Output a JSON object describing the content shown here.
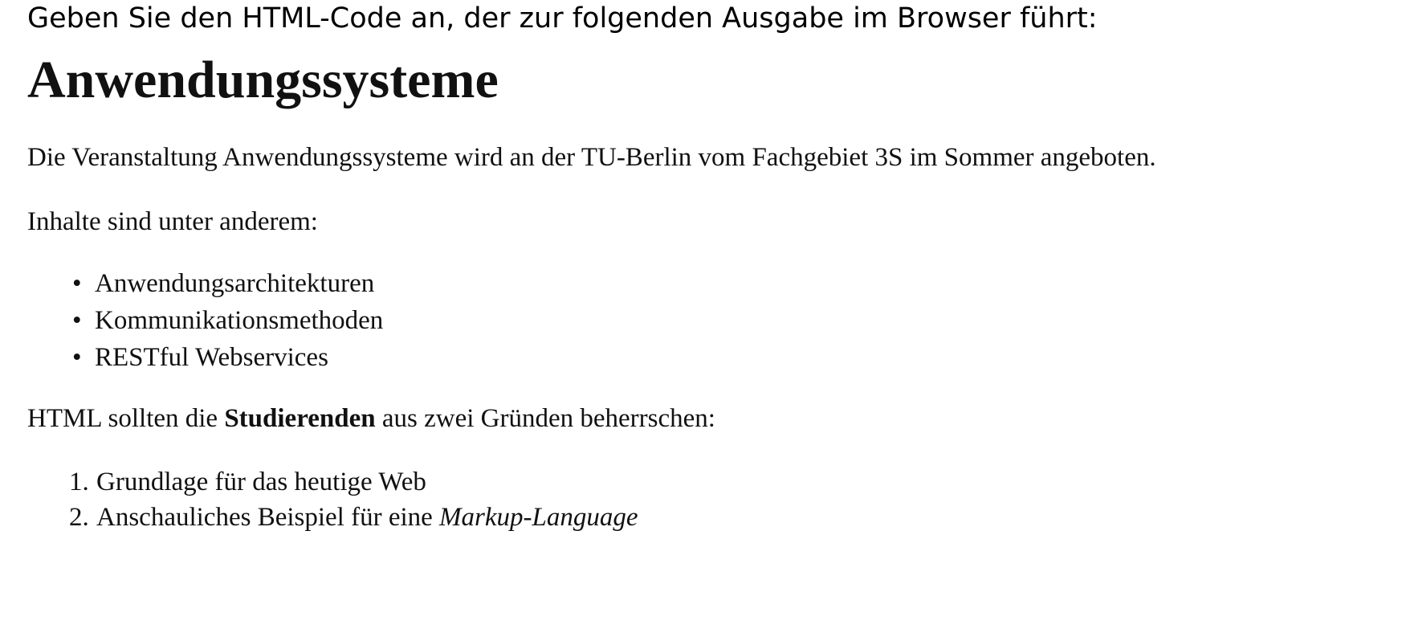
{
  "task": {
    "question": "Geben Sie den HTML-Code an, der zur folgenden Ausgabe im Browser führt:"
  },
  "output": {
    "heading": "Anwendungssysteme",
    "intro": "Die Veranstaltung Anwendungssysteme wird an der TU-Berlin vom Fachgebiet 3S im Sommer angeboten.",
    "contents_intro": "Inhalte sind unter anderem:",
    "bullet_symbol": "•",
    "topics": [
      {
        "label": "Anwendungsarchitekturen"
      },
      {
        "label": "Kommunikationsmethoden"
      },
      {
        "label": "RESTful Webservices"
      }
    ],
    "html_para": {
      "before": "HTML sollten die ",
      "bold": "Studierenden",
      "after": " aus zwei Gründen beherrschen:"
    },
    "reasons": [
      {
        "num": "1.",
        "text": "Grundlage für das heutige Web",
        "italic": ""
      },
      {
        "num": "2.",
        "text": "Anschauliches Beispiel für eine ",
        "italic": "Markup-Language"
      }
    ]
  }
}
